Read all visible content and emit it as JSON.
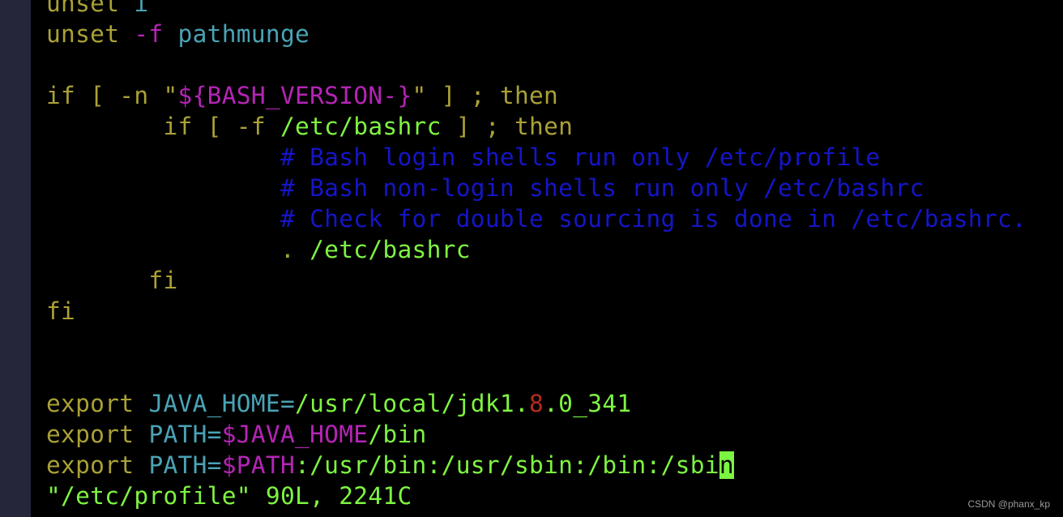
{
  "colors": {
    "kw": "#aaa136",
    "opt": "#b524b5",
    "var": "#4aa3b5",
    "str": "#7ef442",
    "cmt": "#1515c8",
    "num": "#b52a1c",
    "gutter": "#25263a"
  },
  "lines": [
    [
      [
        "unset ",
        "kw"
      ],
      [
        "i",
        "var"
      ]
    ],
    [
      [
        "unset ",
        "kw"
      ],
      [
        "-f",
        "opt"
      ],
      [
        " pathmunge",
        "var"
      ]
    ],
    [],
    [
      [
        "if [ -n \"",
        "kw"
      ],
      [
        "${BASH_VERSION-}",
        "opt"
      ],
      [
        "\" ] ; then",
        "kw"
      ]
    ],
    [
      [
        "        if [ -f ",
        "kw"
      ],
      [
        "/etc/bashrc",
        "str"
      ],
      [
        " ] ; then",
        "kw"
      ]
    ],
    [
      [
        "                # Bash login shells run only /etc/profile",
        "cmt"
      ]
    ],
    [
      [
        "                # Bash non-login shells run only /etc/bashrc",
        "cmt"
      ]
    ],
    [
      [
        "                # Check for double sourcing is done in /etc/bashrc.",
        "cmt"
      ]
    ],
    [
      [
        "                . ",
        "kw"
      ],
      [
        "/etc/bashrc",
        "str"
      ]
    ],
    [
      [
        "       fi",
        "kw"
      ]
    ],
    [
      [
        "fi",
        "kw"
      ]
    ],
    [],
    [],
    [
      [
        "export ",
        "kw"
      ],
      [
        "JAVA_HOME=",
        "var"
      ],
      [
        "/usr/local/jdk1.",
        "str"
      ],
      [
        "8",
        "num"
      ],
      [
        ".0_341",
        "str"
      ]
    ],
    [
      [
        "export ",
        "kw"
      ],
      [
        "PATH=",
        "var"
      ],
      [
        "$JAVA_HOME",
        "opt"
      ],
      [
        "/bin",
        "str"
      ]
    ],
    [
      [
        "export ",
        "kw"
      ],
      [
        "PATH=",
        "var"
      ],
      [
        "$PATH",
        "opt"
      ],
      [
        ":/usr/bin:/usr/sbin:/bin:/sbi",
        "str"
      ],
      [
        "n",
        "cursor"
      ]
    ],
    [
      [
        "\"/etc/profile\" 90L, 2241C",
        "str"
      ]
    ]
  ],
  "watermark": "CSDN @phanx_kp"
}
